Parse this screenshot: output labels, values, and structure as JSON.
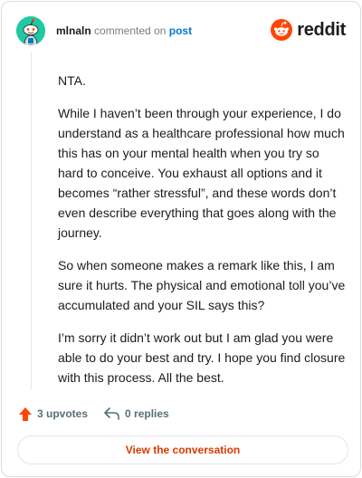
{
  "comment": {
    "username": "mlnaln",
    "verb": "commented on",
    "target": "post",
    "paragraphs": [
      "NTA.",
      "While I haven’t been through your experience, I do understand as a healthcare professional how much this has on your mental health when you try so hard to conceive. You exhaust all options and it becomes “rather stressful”, and these words don’t even describe everything that goes along with the journey.",
      "So when someone makes a remark like this, I am sure it hurts. The physical and emotional toll you’ve accumulated and your SIL says this?",
      "I’m sorry it didn’t work out but I am glad you were able to do your best and try. I hope you find closure with this process. All the best."
    ]
  },
  "brand": {
    "name": "reddit",
    "color": "#ff4500"
  },
  "actions": {
    "upvotes": "3 upvotes",
    "replies": "0 replies"
  },
  "cta": {
    "label": "View the conversation"
  },
  "icons": {
    "avatar": "snoo-avatar-icon",
    "upvote": "upvote-arrow-icon",
    "reply": "reply-arrow-icon",
    "logo": "reddit-logo-icon"
  }
}
